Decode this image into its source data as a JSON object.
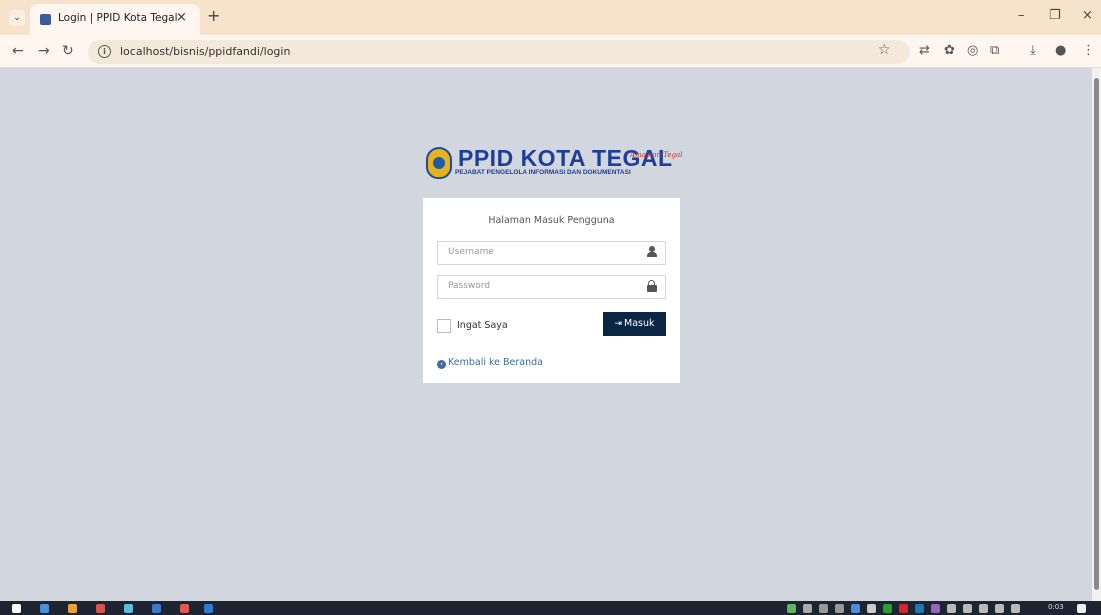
{
  "browser": {
    "tab_title": "Login | PPID Kota Tegal",
    "tab_close": "×",
    "new_tab": "+",
    "url": "localhost/bisnis/ppidfandi/login",
    "window_controls": {
      "minimize": "–",
      "restore": "❐",
      "close": "×"
    }
  },
  "logo": {
    "title": "PPID KOTA TEGAL",
    "subtitle": "PEJABAT PENGELOLA INFORMASI DAN DOKUMENTASI",
    "signature": "Amalkan Tegal"
  },
  "login": {
    "title": "Halaman Masuk Pengguna",
    "username_placeholder": "Username",
    "password_placeholder": "Password",
    "remember_label": "Ingat Saya",
    "submit_label": "Masuk",
    "back_link": "Kembali ke Beranda"
  },
  "taskbar": {
    "clock": "0:03"
  },
  "colors": {
    "page_bg": "#d2d6de",
    "submit_bg": "#0b2545",
    "link": "#3c6da0",
    "logo_blue": "#1d3f9a",
    "tab_strip": "#f7e3cc"
  }
}
